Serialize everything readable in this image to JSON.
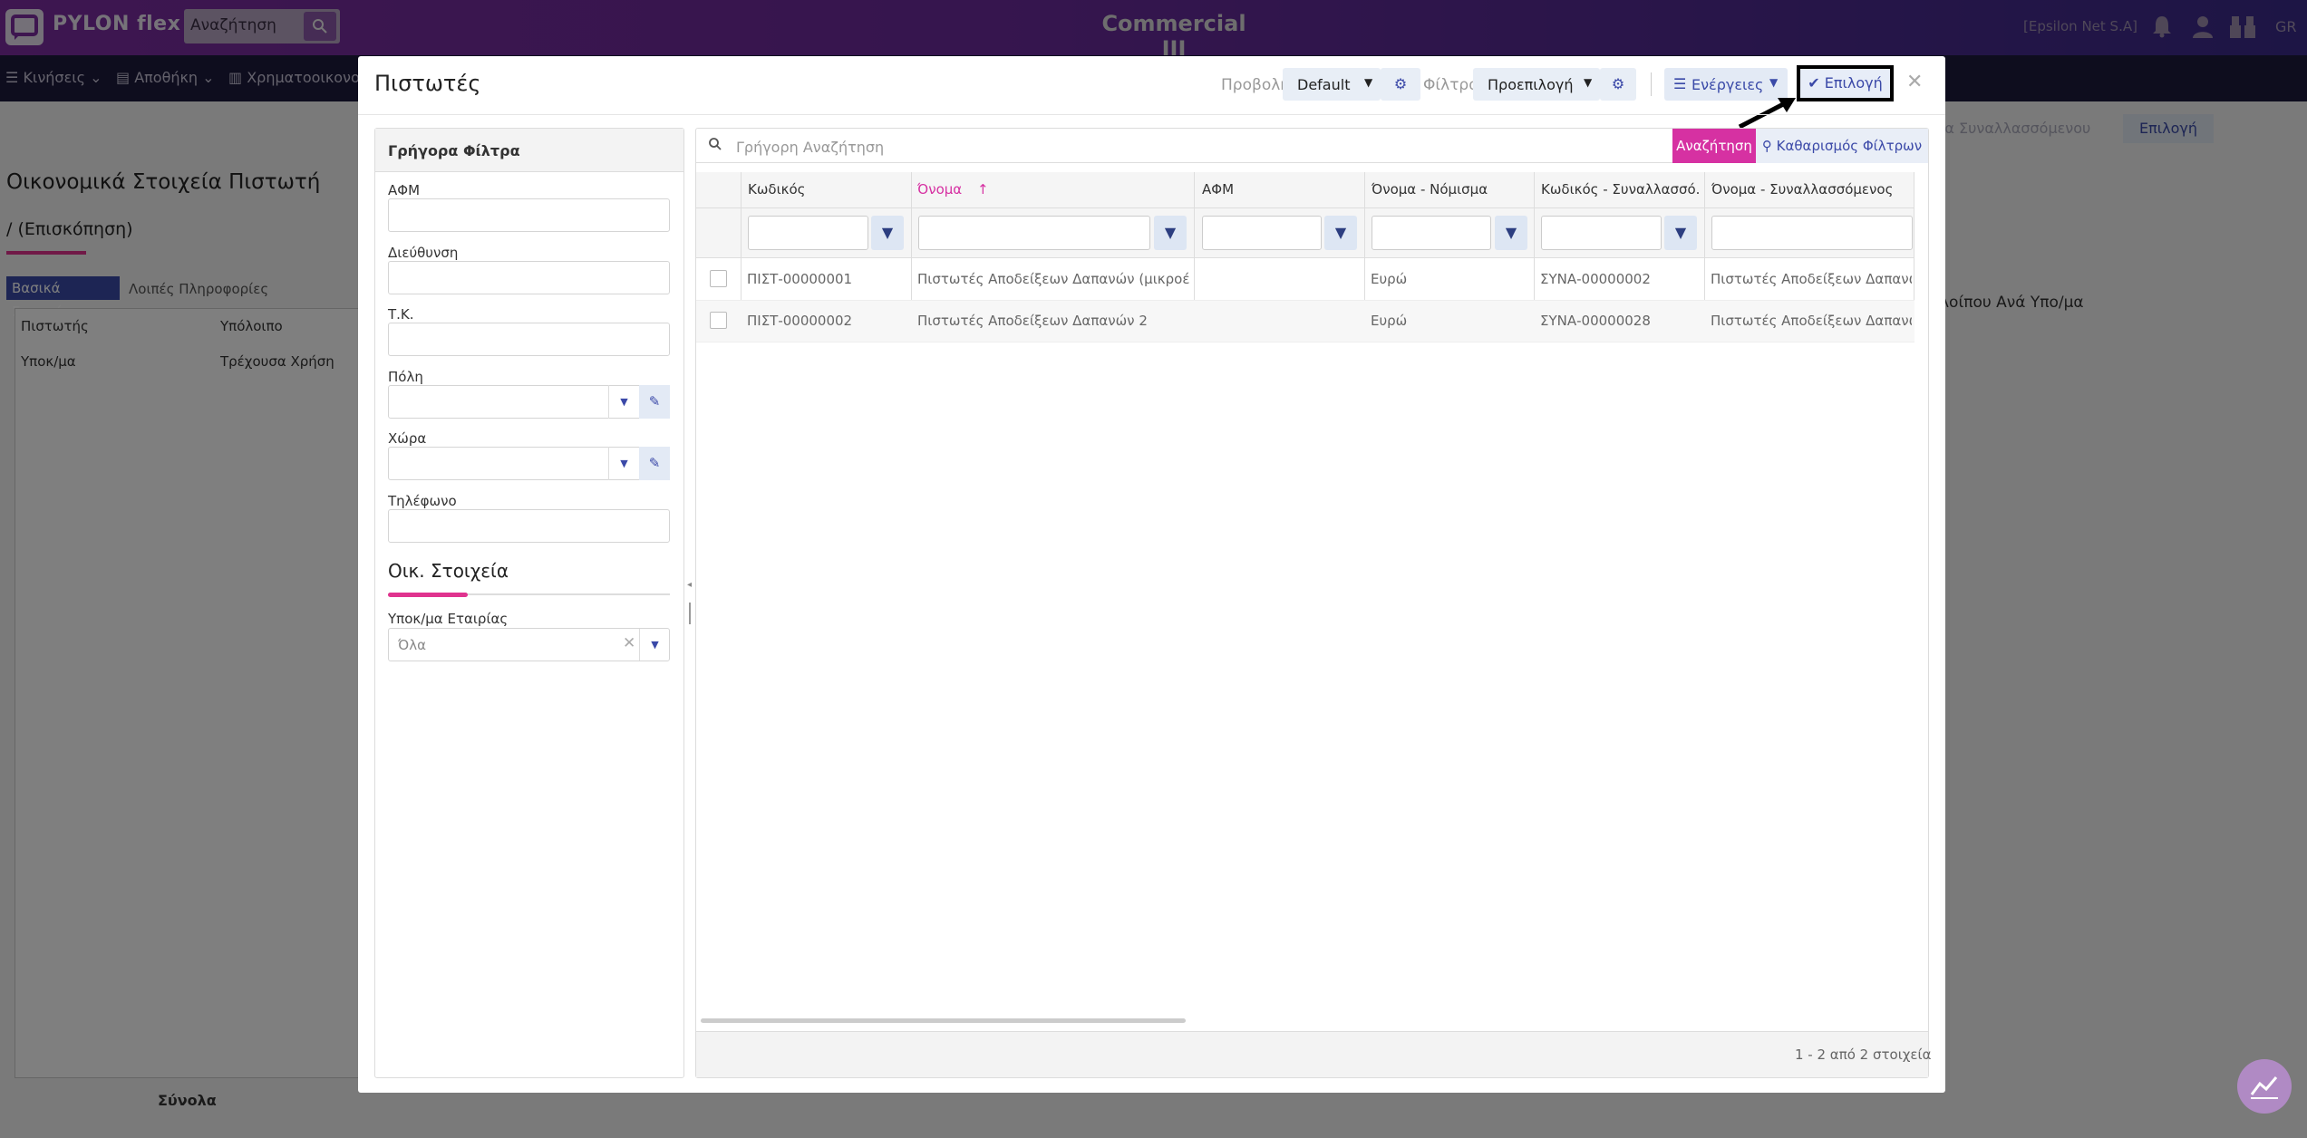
{
  "topbar": {
    "logo_text": "PYLON flex",
    "search_value": "Αναζήτηση",
    "title": "Commercial III",
    "company": "[Epsilon Net S.A]",
    "lang": "GR"
  },
  "nav": {
    "items": [
      "Κινήσεις",
      "Αποθήκη",
      "Χρηματοοικονομ"
    ]
  },
  "background": {
    "title": "Οικονομικά Στοιχεία Πιστωτή",
    "subtitle": "/ (Επισκόπηση)",
    "tabs": [
      "Βασικά Στοιχεία",
      "Λοιπές Πληροφορίες"
    ],
    "table_headers": [
      "Πιστωτής",
      "Υπόλοιπο"
    ],
    "table_sub": [
      "Υποκ/μα",
      "Τρέχουσα Χρήση"
    ],
    "footer_label": "Σύνολα",
    "right_text": "λοίπου Ανά Υπο/μα",
    "right_btn_faded": "ία Συναλλασσόμενου",
    "right_btn": "Επιλογή"
  },
  "modal": {
    "title": "Πιστωτές",
    "view_label": "Προβολή",
    "view_value": "Default",
    "filters_label": "Φίλτρα",
    "filters_value": "Προεπιλογή",
    "actions_label": "Ενέργειες",
    "select_label": "Επιλογή"
  },
  "filters_panel": {
    "title": "Γρήγορα Φίλτρα",
    "afm": "ΑΦΜ",
    "address": "Διεύθυνση",
    "zip": "Τ.Κ.",
    "city": "Πόλη",
    "country": "Χώρα",
    "phone": "Τηλέφωνο",
    "fin_heading": "Οικ. Στοιχεία",
    "subsidiary_label": "Υποκ/μα Εταιρίας",
    "subsidiary_value": "Όλα"
  },
  "grid": {
    "search_placeholder": "Γρήγορη Αναζήτηση",
    "search_btn": "Αναζήτηση",
    "clear_btn": "Καθαρισμός Φίλτρων",
    "columns": [
      "Κωδικός",
      "Όνομα",
      "ΑΦΜ",
      "Όνομα - Νόμισμα",
      "Κωδικός - Συναλλασσό...",
      "Όνομα - Συναλλασσόμενος"
    ],
    "rows": [
      [
        "ΠΙΣΤ-00000001",
        "Πιστωτές Αποδείξεων Δαπανών (μικροέξ...",
        "",
        "Ευρώ",
        "ΣΥΝΑ-00000002",
        "Πιστωτές Αποδείξεων Δαπανών"
      ],
      [
        "ΠΙΣΤ-00000002",
        "Πιστωτές Αποδείξεων Δαπανών 2",
        "",
        "Ευρώ",
        "ΣΥΝΑ-00000028",
        "Πιστωτές Αποδείξεων Δαπανών"
      ]
    ],
    "pager": "1 - 2 από 2 στοιχεία",
    "sort_color": "#d631a2"
  }
}
